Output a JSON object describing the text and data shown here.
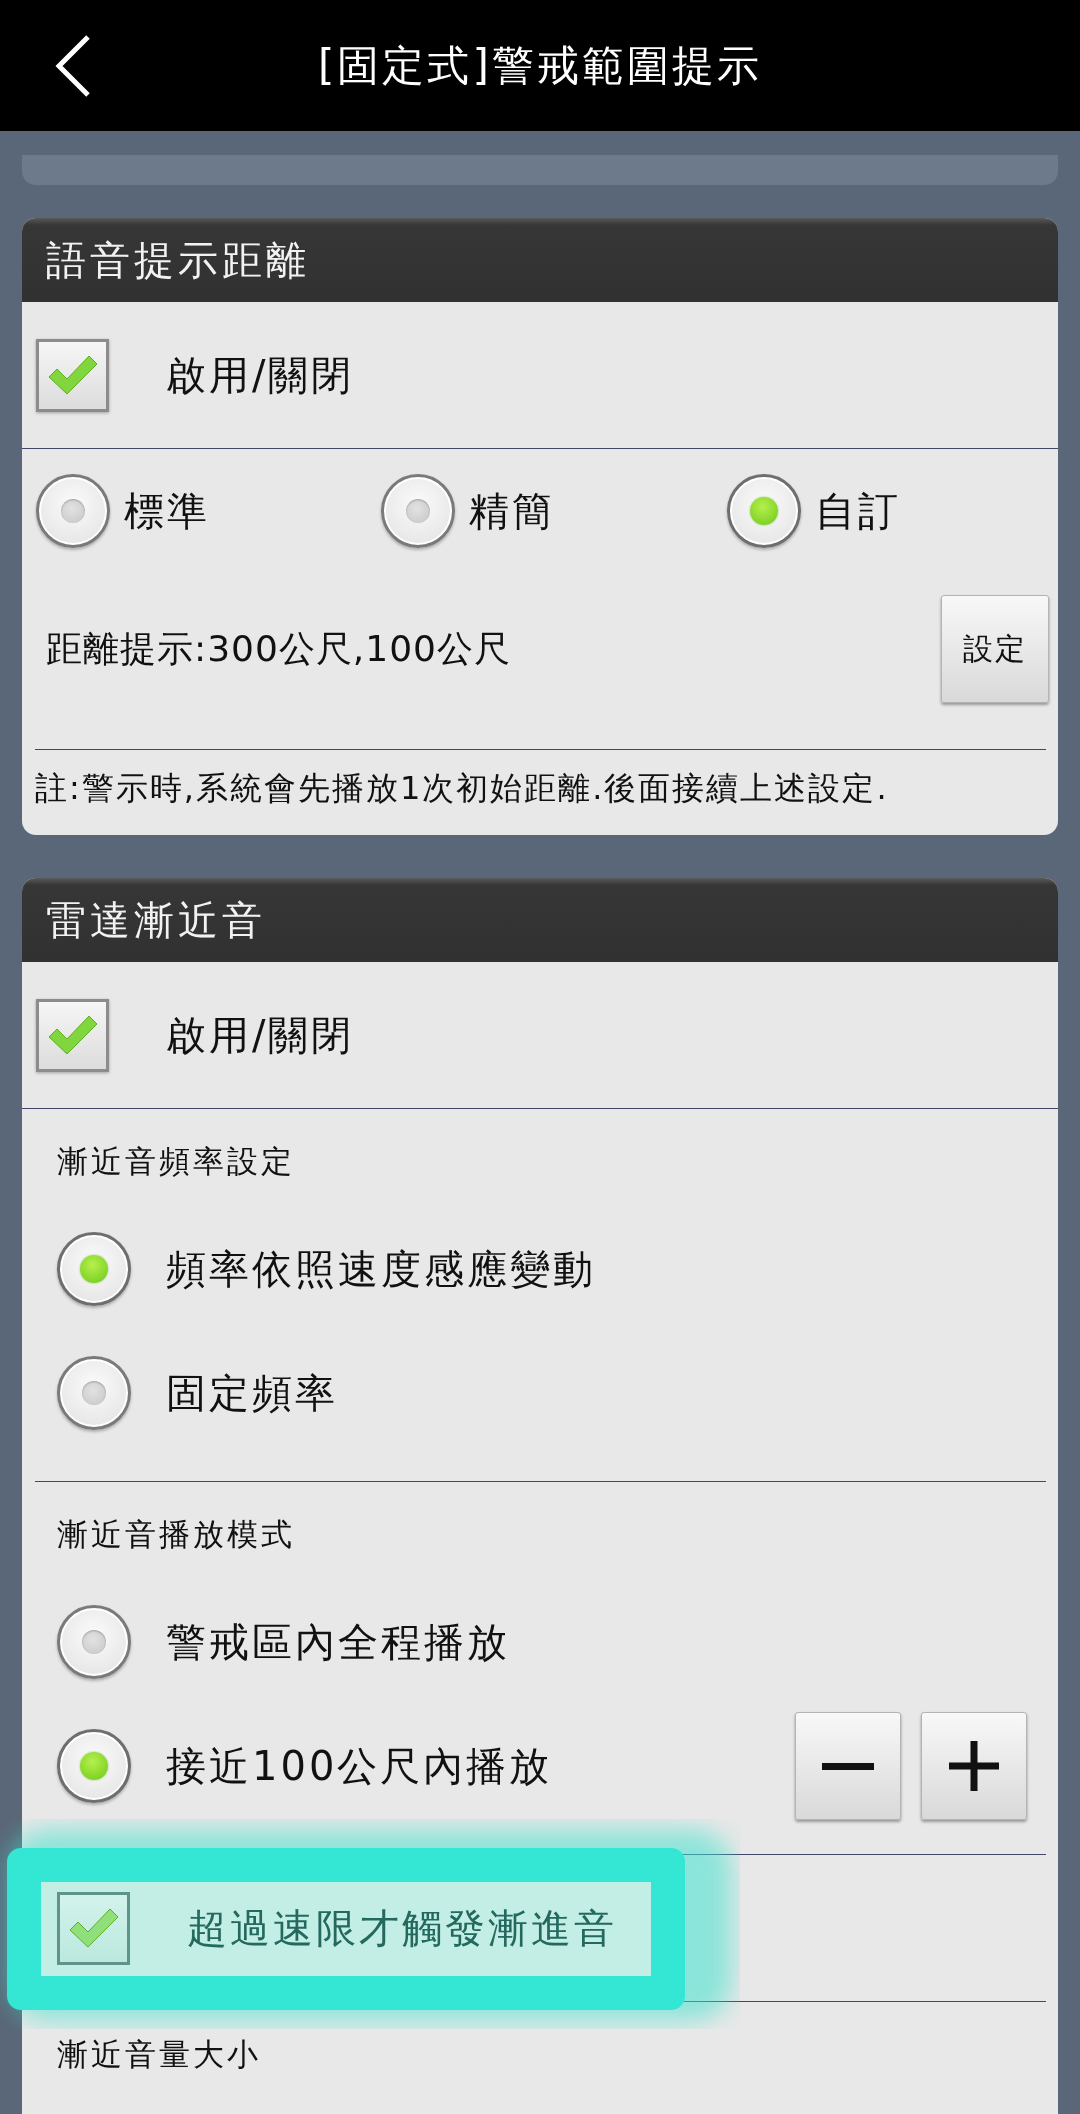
{
  "top_bar": {
    "title": "[固定式]警戒範圍提示"
  },
  "sections": [
    {
      "title": "語音提示距離",
      "groups": [
        {
          "items": [
            {
              "kind": "checkbox",
              "label": "啟用/關閉",
              "checked": true,
              "highlighted": false
            }
          ]
        },
        {
          "items": [
            {
              "kind": "radio_row",
              "options": [
                {
                  "label": "標準",
                  "selected": false
                },
                {
                  "label": "精簡",
                  "selected": false
                },
                {
                  "label": "自訂",
                  "selected": true
                }
              ]
            },
            {
              "kind": "value_button",
              "text": "距離提示:300公尺,100公尺",
              "button": "設定"
            }
          ]
        },
        {
          "items": [
            {
              "kind": "note",
              "text": "註:警示時,系統會先播放1次初始距離.後面接續上述設定."
            }
          ]
        }
      ]
    },
    {
      "title": "雷達漸近音",
      "groups": [
        {
          "items": [
            {
              "kind": "checkbox",
              "label": "啟用/關閉",
              "checked": true,
              "highlighted": false
            }
          ]
        },
        {
          "items": [
            {
              "kind": "heading",
              "text": "漸近音頻率設定"
            },
            {
              "kind": "radio",
              "label": "頻率依照速度感應變動",
              "selected": true,
              "stepper": false
            },
            {
              "kind": "radio",
              "label": "固定頻率",
              "selected": false,
              "stepper": false
            }
          ]
        },
        {
          "items": [
            {
              "kind": "heading",
              "text": "漸近音播放模式"
            },
            {
              "kind": "radio",
              "label": "警戒區內全程播放",
              "selected": false,
              "stepper": false
            },
            {
              "kind": "radio",
              "label": "接近100公尺內播放",
              "selected": true,
              "stepper": true
            }
          ]
        },
        {
          "items": [
            {
              "kind": "checkbox",
              "label": "超過速限才觸發漸進音",
              "checked": true,
              "highlighted": true
            }
          ]
        },
        {
          "items": [
            {
              "kind": "heading",
              "text": "漸近音量大小"
            }
          ]
        }
      ]
    }
  ]
}
